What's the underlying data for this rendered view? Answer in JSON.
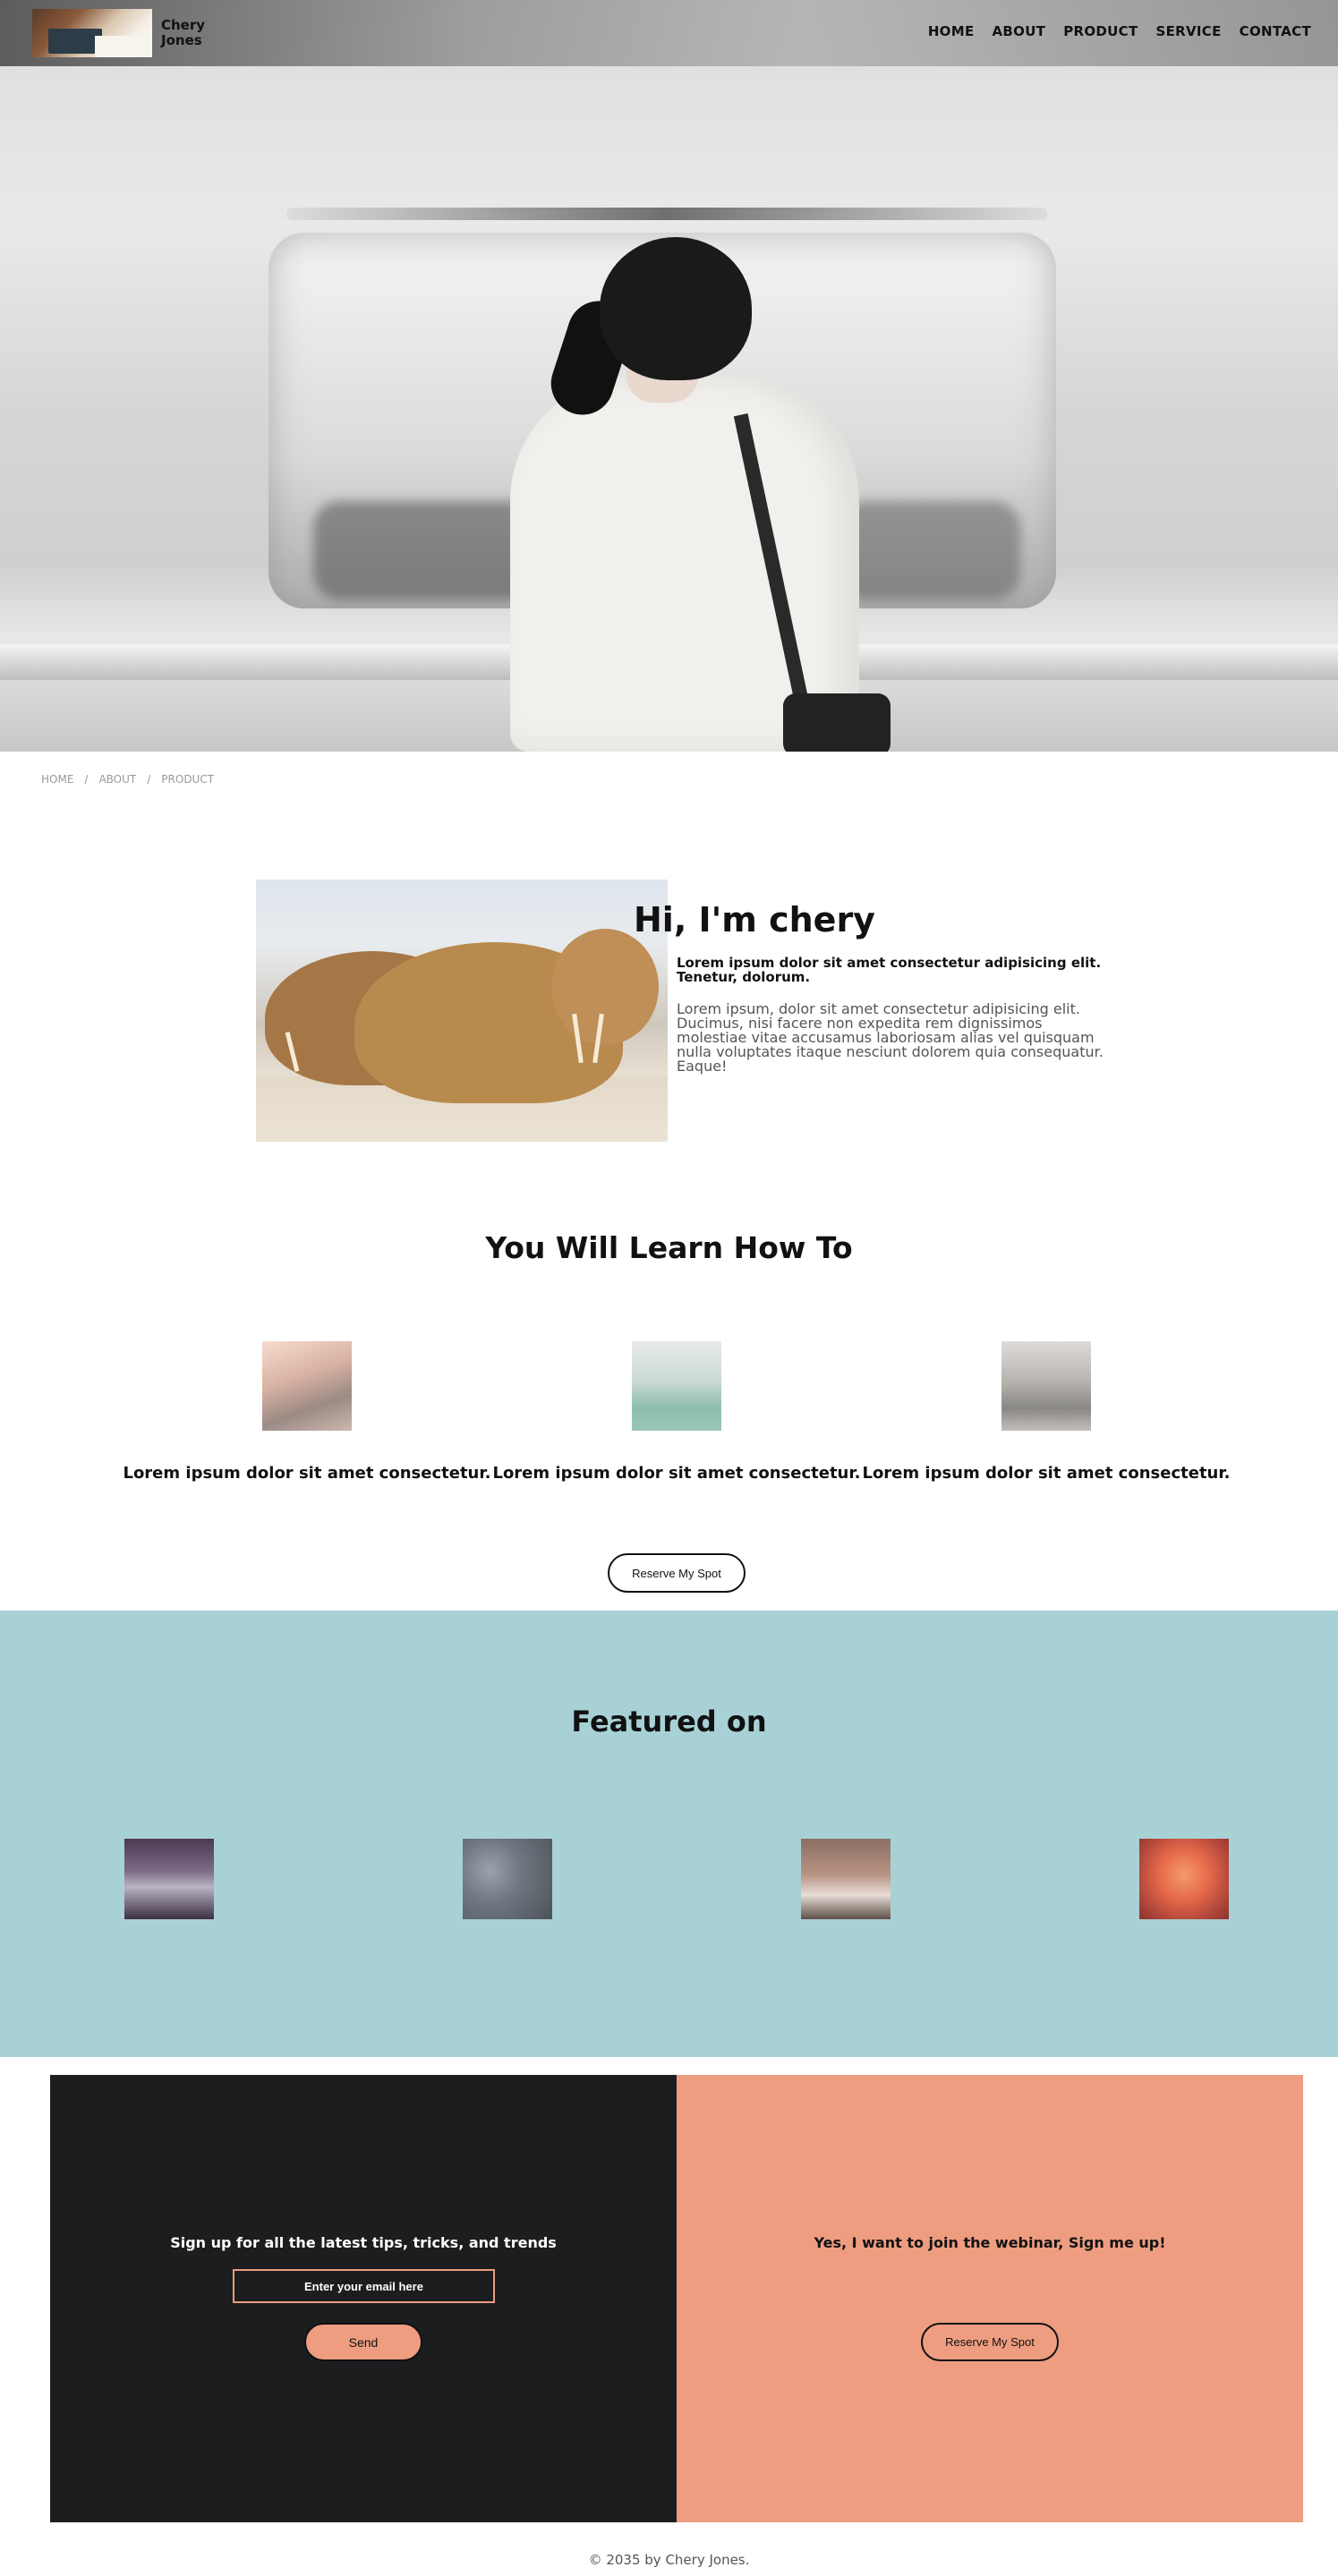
{
  "header": {
    "logo_text": "Chery Jones",
    "nav": [
      "HOME",
      "ABOUT",
      "PRODUCT",
      "SERVICE",
      "CONTACT"
    ]
  },
  "breadcrumb": [
    "HOME",
    "ABOUT",
    "PRODUCT"
  ],
  "about": {
    "title": "Hi, I'm chery",
    "subtitle": "Lorem ipsum dolor sit amet consectetur adipisicing elit. Tenetur, dolorum.",
    "body": "Lorem ipsum, dolor sit amet consectetur adipisicing elit. Ducimus, nisi facere non expedita rem dignissimos molestiae vitae accusamus laboriosam alias vel quisquam nulla voluptates itaque nesciunt dolorem quia consequatur. Eaque!"
  },
  "learn": {
    "title": "You Will Learn How To",
    "items": [
      "Lorem ipsum dolor sit amet consectetur.",
      "Lorem ipsum dolor sit amet consectetur.",
      "Lorem ipsum dolor sit amet consectetur."
    ],
    "button": "Reserve My Spot"
  },
  "featured": {
    "title": "Featured on"
  },
  "signup": {
    "title": "Sign up for all the latest tips, tricks, and trends",
    "email_placeholder": "Enter your email here",
    "send_button": "Send"
  },
  "webinar": {
    "title": "Yes, I want to join the webinar, Sign me up!",
    "button": "Reserve My Spot"
  },
  "footer": {
    "copyright": "© 2035 by Chery Jones."
  },
  "colors": {
    "featured_bg": "#a8d1d6",
    "signup_dark": "#1c1d1f",
    "accent_salmon": "#ee9d81"
  }
}
